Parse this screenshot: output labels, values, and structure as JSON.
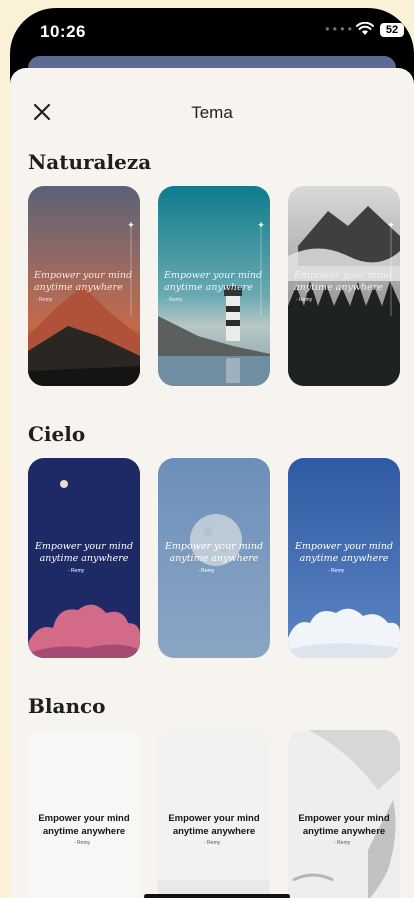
{
  "status": {
    "time": "10:26",
    "battery": "52"
  },
  "sheet": {
    "title": "Tema"
  },
  "sections": [
    {
      "title": "Naturaleza"
    },
    {
      "title": "Cielo"
    },
    {
      "title": "Blanco"
    }
  ],
  "quote": {
    "line1": "Empower your mind",
    "line2": "anytime anywhere",
    "author": "- Remy"
  }
}
